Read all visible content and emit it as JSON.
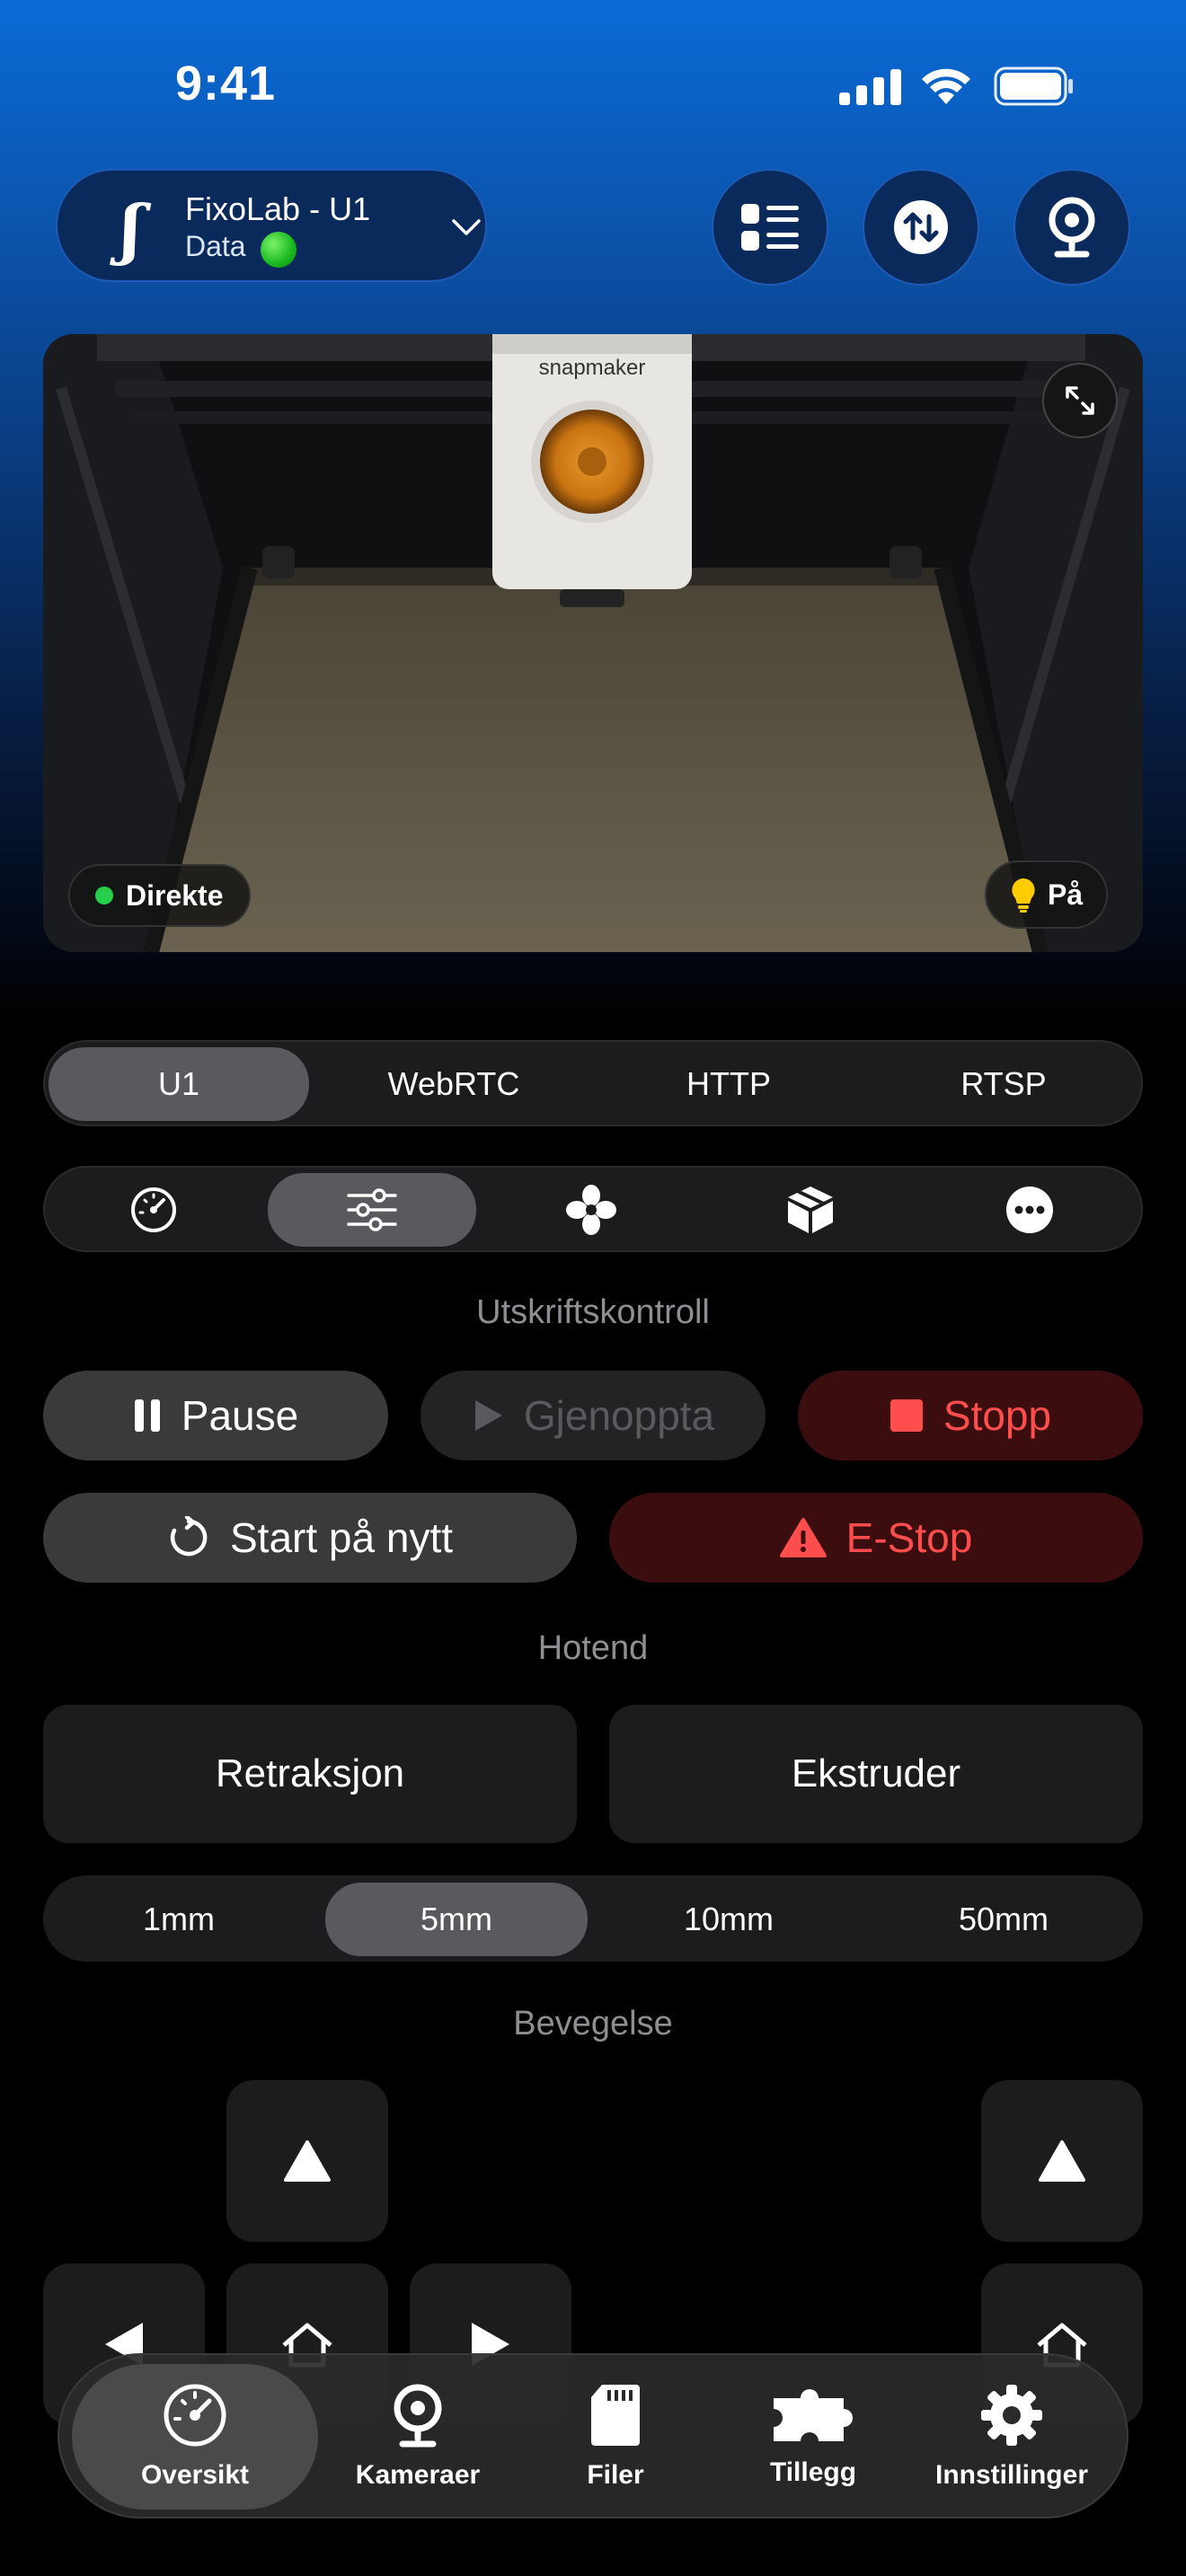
{
  "status_bar": {
    "time": "9:41"
  },
  "header": {
    "printer_name": "FixoLab - U1",
    "printer_sub": "Data",
    "logo_glyph": "ʃ",
    "buttons": [
      "list-icon",
      "transfer-icon",
      "webcam-icon"
    ]
  },
  "camera": {
    "live_label": "Direkte",
    "light_label": "På",
    "brand_text": "snapmaker"
  },
  "stream_tabs": [
    "U1",
    "WebRTC",
    "HTTP",
    "RTSP"
  ],
  "stream_selected": "U1",
  "panel_tabs": [
    "dashboard-icon",
    "sliders-icon",
    "fan-icon",
    "box-icon",
    "more-icon"
  ],
  "panel_selected": "sliders-icon",
  "print_control": {
    "title": "Utskriftskontroll",
    "pause": "Pause",
    "resume": "Gjenoppta",
    "stop": "Stopp",
    "restart": "Start på nytt",
    "estop": "E-Stop"
  },
  "hotend": {
    "title": "Hotend",
    "retract": "Retraksjon",
    "extrude": "Ekstruder",
    "distances": [
      "1mm",
      "5mm",
      "10mm",
      "50mm"
    ],
    "selected": "5mm"
  },
  "movement": {
    "title": "Bevegelse"
  },
  "tabbar": [
    {
      "label": "Oversikt",
      "icon": "gauge-icon",
      "active": true
    },
    {
      "label": "Kameraer",
      "icon": "webcam-icon",
      "active": false
    },
    {
      "label": "Filer",
      "icon": "sdcard-icon",
      "active": false
    },
    {
      "label": "Tillegg",
      "icon": "puzzle-icon",
      "active": false
    },
    {
      "label": "Innstillinger",
      "icon": "gear-icon",
      "active": false
    }
  ],
  "colors": {
    "accent_red": "#ff4d4d",
    "live_green": "#27d04a",
    "header_blue": "#0a6bd6"
  }
}
